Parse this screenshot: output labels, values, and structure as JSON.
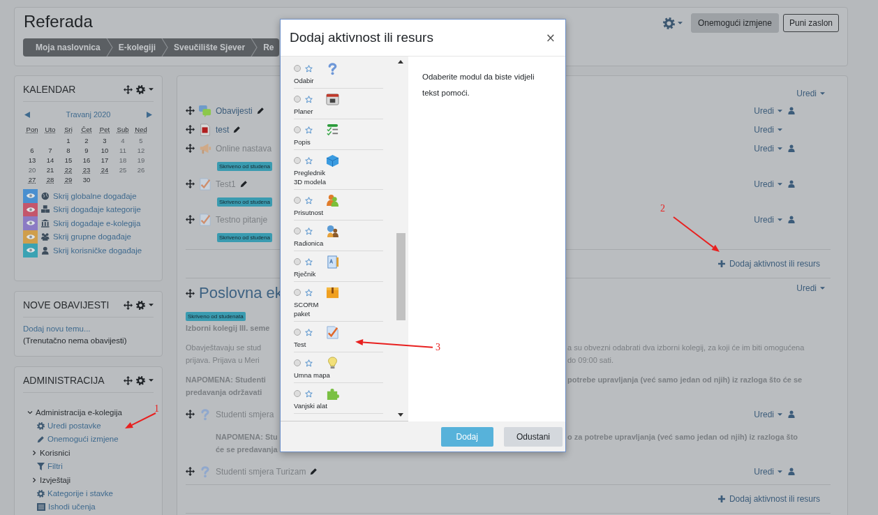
{
  "header": {
    "title": "Referada",
    "breadcrumb": [
      "Moja naslovnica",
      "E-kolegiji",
      "Sveučilište Sjever",
      "Re"
    ],
    "buttons": [
      {
        "label": "Onemogući izmjene",
        "kind": "filled"
      },
      {
        "label": "Puni zaslon",
        "kind": "outline"
      }
    ]
  },
  "calendar": {
    "title": "KALENDAR",
    "month": "Travanj 2020",
    "weekdays": [
      "Pon",
      "Uto",
      "Sri",
      "Čet",
      "Pet",
      "Sub",
      "Ned"
    ],
    "weeks": [
      [
        {
          "day": "1",
          "muted": false,
          "event": false
        },
        {
          "day": "2",
          "muted": false,
          "event": false
        },
        {
          "day": "3",
          "muted": false,
          "event": false
        },
        {
          "day": "4",
          "muted": true,
          "event": false
        },
        {
          "day": "5",
          "muted": true,
          "event": false
        }
      ],
      [
        {
          "day": "6",
          "muted": false,
          "event": false
        },
        {
          "day": "7",
          "muted": false,
          "event": false
        },
        {
          "day": "8",
          "muted": false,
          "event": false
        },
        {
          "day": "9",
          "muted": false,
          "event": false
        },
        {
          "day": "10",
          "muted": false,
          "event": false
        },
        {
          "day": "11",
          "muted": true,
          "event": false
        },
        {
          "day": "12",
          "muted": true,
          "event": false
        }
      ],
      [
        {
          "day": "13",
          "muted": false,
          "event": false
        },
        {
          "day": "14",
          "muted": false,
          "event": false
        },
        {
          "day": "15",
          "muted": false,
          "event": false
        },
        {
          "day": "16",
          "muted": false,
          "event": false
        },
        {
          "day": "17",
          "muted": false,
          "event": false
        },
        {
          "day": "18",
          "muted": true,
          "event": false
        },
        {
          "day": "19",
          "muted": true,
          "event": false
        }
      ],
      [
        {
          "day": "20",
          "muted": true,
          "event": false
        },
        {
          "day": "21",
          "muted": false,
          "event": false
        },
        {
          "day": "22",
          "muted": false,
          "event": true
        },
        {
          "day": "23",
          "muted": false,
          "event": true
        },
        {
          "day": "24",
          "muted": false,
          "event": true
        },
        {
          "day": "25",
          "muted": true,
          "event": false
        },
        {
          "day": "26",
          "muted": true,
          "event": false
        }
      ],
      [
        {
          "day": "27",
          "muted": false,
          "event": true
        },
        {
          "day": "28",
          "muted": false,
          "event": true
        },
        {
          "day": "29",
          "muted": false,
          "event": true
        },
        {
          "day": "30",
          "muted": false,
          "event": false
        }
      ]
    ],
    "filters": [
      {
        "label": "Skrij globalne događaje",
        "kind": "global",
        "color": "#4a8fcf"
      },
      {
        "label": "Skrij događaje kategorije",
        "kind": "category",
        "color": "#c4566b"
      },
      {
        "label": "Skrij događaje e-kolegija",
        "kind": "course",
        "color": "#8b7bc4"
      },
      {
        "label": "Skrij grupne događaje",
        "kind": "group",
        "color": "#cf9e4c"
      },
      {
        "label": "Skrij korisničke događaje",
        "kind": "user",
        "color": "#3aa2b3"
      }
    ]
  },
  "news": {
    "title": "NOVE OBAVIJESTI",
    "link": "Dodaj novu temu...",
    "note": "(Trenutačno nema obavijesti)"
  },
  "administration": {
    "title": "ADMINISTRACIJA",
    "tree": [
      {
        "label": "Administracija e-kolegija",
        "kind": "branch",
        "expanded": true,
        "children": [
          {
            "label": "Uredi postavke",
            "kind": "gear"
          },
          {
            "label": "Onemogući izmjene",
            "kind": "pencil"
          },
          {
            "label": "Korisnici",
            "kind": "branch",
            "expanded": false
          },
          {
            "label": "Filtri",
            "kind": "filter"
          },
          {
            "label": "Izvještaji",
            "kind": "branch",
            "expanded": false
          },
          {
            "label": "Kategorije i stavke",
            "kind": "gear"
          },
          {
            "label": "Ishodi učenja",
            "kind": "outcomes"
          }
        ]
      }
    ]
  },
  "main": {
    "rows": [
      {
        "kind": "section_edit",
        "action": "Uredi"
      },
      {
        "kind": "forum",
        "name": "Obavijesti",
        "hidden": false,
        "edit_icon": true,
        "action": "Uredi",
        "roles_icon": true
      },
      {
        "kind": "file",
        "name": "test",
        "hidden": false,
        "edit_icon": true,
        "action": "Uredi",
        "roles_icon": false
      },
      {
        "kind": "announcement",
        "name": "Online nastava",
        "hidden": true,
        "edit_icon": false,
        "action": "Uredi",
        "roles_icon": true
      },
      {
        "kind": "badge",
        "text": "Skriveno od studena"
      },
      {
        "kind": "quiz",
        "name": "Test1",
        "hidden": true,
        "edit_icon": true,
        "action": "Uredi",
        "roles_icon": true
      },
      {
        "kind": "badge",
        "text": "Skriveno od studena"
      },
      {
        "kind": "quiz",
        "name": "Testno pitanje",
        "hidden": true,
        "edit_icon": false,
        "action": "Uredi",
        "roles_icon": true
      },
      {
        "kind": "badge",
        "text": "Skriveno od studena"
      },
      {
        "kind": "add",
        "text": "Dodaj aktivnost ili resurs"
      },
      {
        "kind": "section_title",
        "title": "Poslovna ek",
        "action": "Uredi"
      },
      {
        "kind": "section_badge",
        "text": "Skriveno od studenata"
      },
      {
        "kind": "section_text",
        "bold": true,
        "left": [
          "Izborni kolegij III. seme"
        ]
      },
      {
        "kind": "section_text",
        "bold": false,
        "left": [
          "Obavještavaju se stud",
          "prijava. Prijava u Meri"
        ],
        "right": [
          "a su obvezni odabrati dva izborni kolegij, za koji će im biti omogućena",
          "do 09:00 sati."
        ]
      },
      {
        "kind": "section_text",
        "bold": true,
        "left": [
          "NAPOMENA: Studenti",
          "predavanja održavati"
        ],
        "right": [
          "potrebe upravljanja (već samo jedan od njih) iz razloga što će se"
        ]
      },
      {
        "kind": "question",
        "name": "Studenti smjera",
        "hidden": true,
        "edit_icon": false,
        "action": "Uredi",
        "roles_icon": true
      },
      {
        "kind": "activity_text",
        "bold": true,
        "left": [
          "NAPOMENA: Stu",
          "će se predavanja"
        ],
        "right": [
          "o za potrebe upravljanja (već samo jedan od njih) iz razloga što"
        ]
      },
      {
        "kind": "question",
        "name": "Studenti smjera Turizam",
        "hidden": true,
        "edit_icon": true,
        "action": "Uredi",
        "roles_icon": true
      },
      {
        "kind": "add",
        "text": "Dodaj aktivnost ili resurs"
      }
    ]
  },
  "modal": {
    "title": "Dodaj aktivnost ili resurs",
    "close": "×",
    "help": "Odaberite modul da biste vidjeli tekst pomoći.",
    "items": [
      {
        "label": "Odabir",
        "kind": "question",
        "selected": false
      },
      {
        "label": "Planer",
        "kind": "calendar",
        "selected": false
      },
      {
        "label": "Popis",
        "kind": "checklist",
        "selected": false
      },
      {
        "label": "Preglednik\n3D modela",
        "kind": "cube",
        "selected": false
      },
      {
        "label": "Prisutnost",
        "kind": "people",
        "selected": false
      },
      {
        "label": "Radionica",
        "kind": "workshop",
        "selected": false
      },
      {
        "label": "Rječnik",
        "kind": "glossary",
        "selected": false
      },
      {
        "label": "SCORM\npaket",
        "kind": "package",
        "selected": false
      },
      {
        "label": "Test",
        "kind": "quiz",
        "selected": false
      },
      {
        "label": "Umna mapa",
        "kind": "bulb",
        "selected": false
      },
      {
        "label": "Vanjski alat",
        "kind": "puzzle",
        "selected": false
      }
    ],
    "buttons": [
      {
        "label": "Dodaj",
        "kind": "primary"
      },
      {
        "label": "Odustani",
        "kind": "secondary"
      }
    ]
  },
  "annotations": [
    {
      "label": "1"
    },
    {
      "label": "2"
    },
    {
      "label": "3"
    }
  ]
}
